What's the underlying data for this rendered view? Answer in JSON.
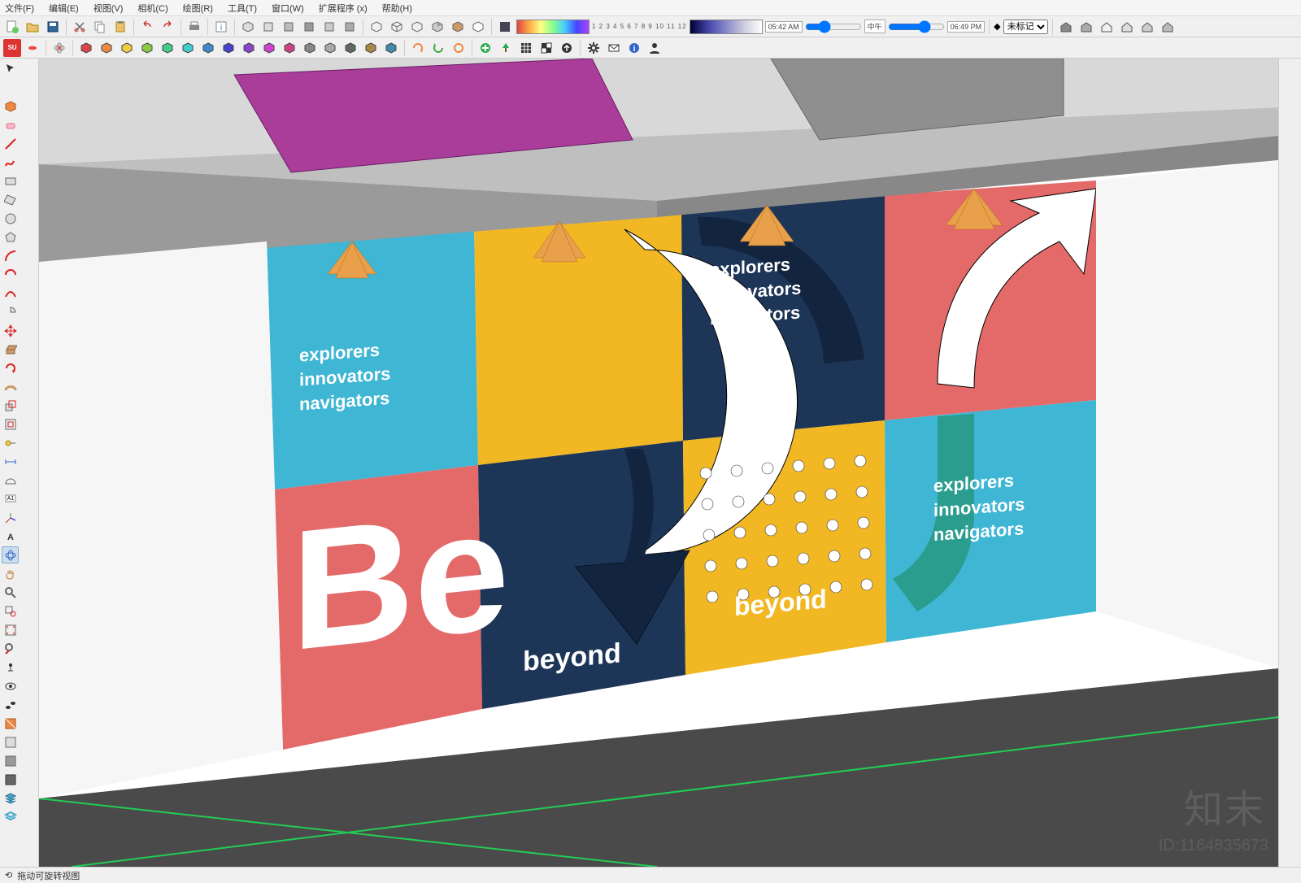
{
  "menu": {
    "file": "文件(F)",
    "edit": "编辑(E)",
    "view": "视图(V)",
    "camera": "相机(C)",
    "draw": "绘图(R)",
    "tools": "工具(T)",
    "window": "窗口(W)",
    "extensions": "扩展程序 (x)",
    "help": "帮助(H)"
  },
  "toolbar": {
    "numstrip": "1 2 3 4 5 6 7 8 9 10 11 12",
    "time_left": "05:42 AM",
    "time_mid": "中午",
    "time_right": "06:49 PM",
    "layer_label": "未标记"
  },
  "status": {
    "hint": "拖动可旋转视图"
  },
  "scene": {
    "panel_text1_l1": "explorers",
    "panel_text1_l2": "innovators",
    "panel_text1_l3": "navigators",
    "panel_text2_l1": "explorers",
    "panel_text2_l2": "innovators",
    "panel_text2_l3": "navigators",
    "panel_text3_l1": "explorers",
    "panel_text3_l2": "innovators",
    "panel_text3_l3": "navigators",
    "be": "Be",
    "beyond1": "beyond",
    "beyond2": "beyond"
  },
  "watermark": {
    "brand": "知末",
    "id": "ID:1164835673"
  },
  "icons": {
    "new": "new-icon",
    "open": "open-icon",
    "save": "save-icon",
    "undo": "undo-icon",
    "redo": "redo-icon",
    "layers": "layers-icon",
    "paint": "paint-icon",
    "select": "select-icon",
    "eraser": "eraser-icon",
    "line": "line-icon",
    "rect": "rect-icon",
    "circle": "circle-icon",
    "arc": "arc-icon",
    "move": "move-icon",
    "rotate": "rotate-icon",
    "scale": "scale-icon",
    "pushpull": "pushpull-icon",
    "tape": "tape-icon",
    "text": "text-icon",
    "orbit": "orbit-icon",
    "pan": "pan-icon",
    "zoom": "zoom-icon",
    "section": "section-icon",
    "warehouse": "warehouse-icon",
    "home": "house-icon"
  }
}
